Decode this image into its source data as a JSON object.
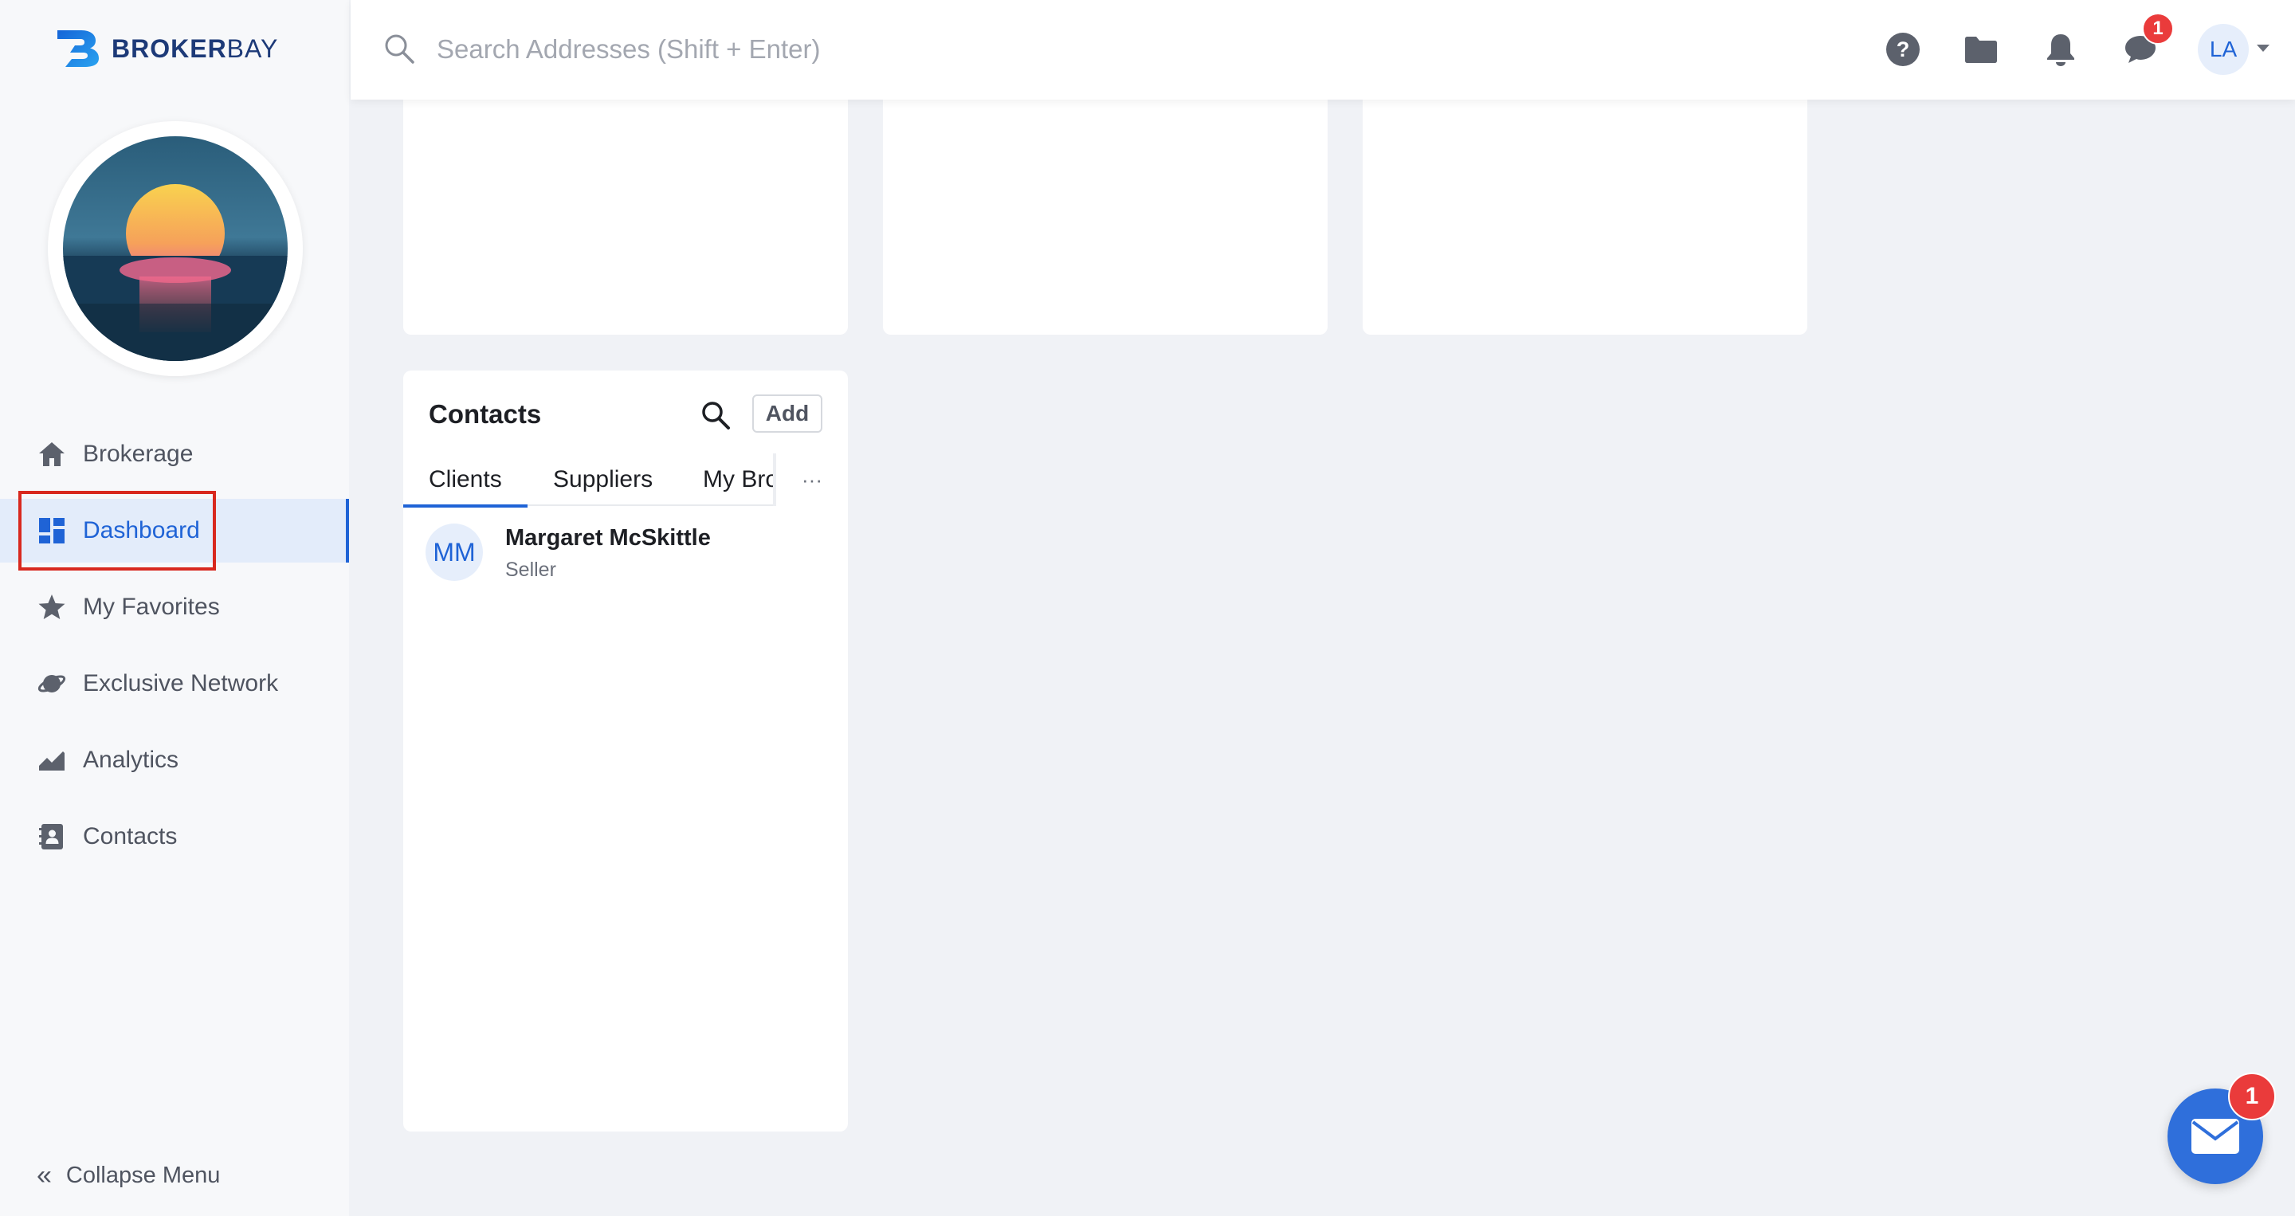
{
  "brand": {
    "name_bold": "BROKER",
    "name_light": "BAY",
    "accent": "#1f63d6"
  },
  "header": {
    "search_placeholder": "Search Addresses (Shift + Enter)",
    "messages_badge": "1",
    "user_initials": "LA"
  },
  "sidebar": {
    "items": [
      {
        "label": "Brokerage",
        "icon": "home-icon"
      },
      {
        "label": "Dashboard",
        "icon": "dashboard-icon",
        "active": true
      },
      {
        "label": "My Favorites",
        "icon": "star-icon"
      },
      {
        "label": "Exclusive Network",
        "icon": "planet-icon"
      },
      {
        "label": "Analytics",
        "icon": "area-chart-icon"
      },
      {
        "label": "Contacts",
        "icon": "contact-book-icon"
      }
    ],
    "collapse_label": "Collapse Menu"
  },
  "contacts": {
    "title": "Contacts",
    "add_label": "Add",
    "tabs": [
      {
        "label": "Clients",
        "active": true
      },
      {
        "label": "Suppliers"
      },
      {
        "label": "My Bro"
      }
    ],
    "more_label": "···",
    "rows": [
      {
        "initials": "MM",
        "name": "Margaret McSkittle",
        "role": "Seller"
      }
    ]
  },
  "mail_fab": {
    "badge": "1"
  }
}
